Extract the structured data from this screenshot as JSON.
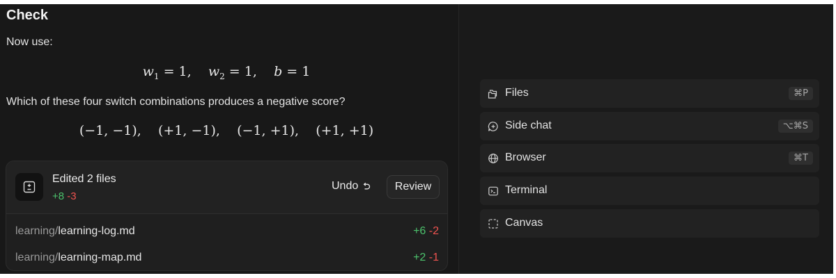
{
  "chat": {
    "title": "Check",
    "intro": "Now use:",
    "equation": {
      "w1": "w",
      "w1_sub": "1",
      "w1_val": " = 1,    ",
      "w2": "w",
      "w2_sub": "2",
      "w2_val": " = 1,    ",
      "b": "b",
      "b_val": " = 1"
    },
    "question": "Which of these four switch combinations produces a negative score?",
    "combinations": "(−1, −1),    (+1, −1),    (−1, +1),    (+1, +1)"
  },
  "edits": {
    "icon": "diff-file-icon",
    "title": "Edited 2 files",
    "additions": "+8",
    "deletions": "-3",
    "undo_label": "Undo",
    "undo_icon": "undo-icon",
    "review_label": "Review",
    "files": [
      {
        "dir": "learning/",
        "name": "learning-log.md",
        "additions": "+6",
        "deletions": "-2"
      },
      {
        "dir": "learning/",
        "name": "learning-map.md",
        "additions": "+2",
        "deletions": "-1"
      }
    ]
  },
  "menu": {
    "items": [
      {
        "label": "Files",
        "shortcut": "⌘P",
        "icon": "files-icon"
      },
      {
        "label": "Side chat",
        "shortcut": "⌥⌘S",
        "icon": "side-chat-icon"
      },
      {
        "label": "Browser",
        "shortcut": "⌘T",
        "icon": "globe-icon"
      },
      {
        "label": "Terminal",
        "shortcut": "",
        "icon": "terminal-icon"
      },
      {
        "label": "Canvas",
        "shortcut": "",
        "icon": "canvas-icon"
      }
    ]
  },
  "colors": {
    "background": "#181818",
    "additions": "#4cc26c",
    "deletions": "#ef5350"
  }
}
